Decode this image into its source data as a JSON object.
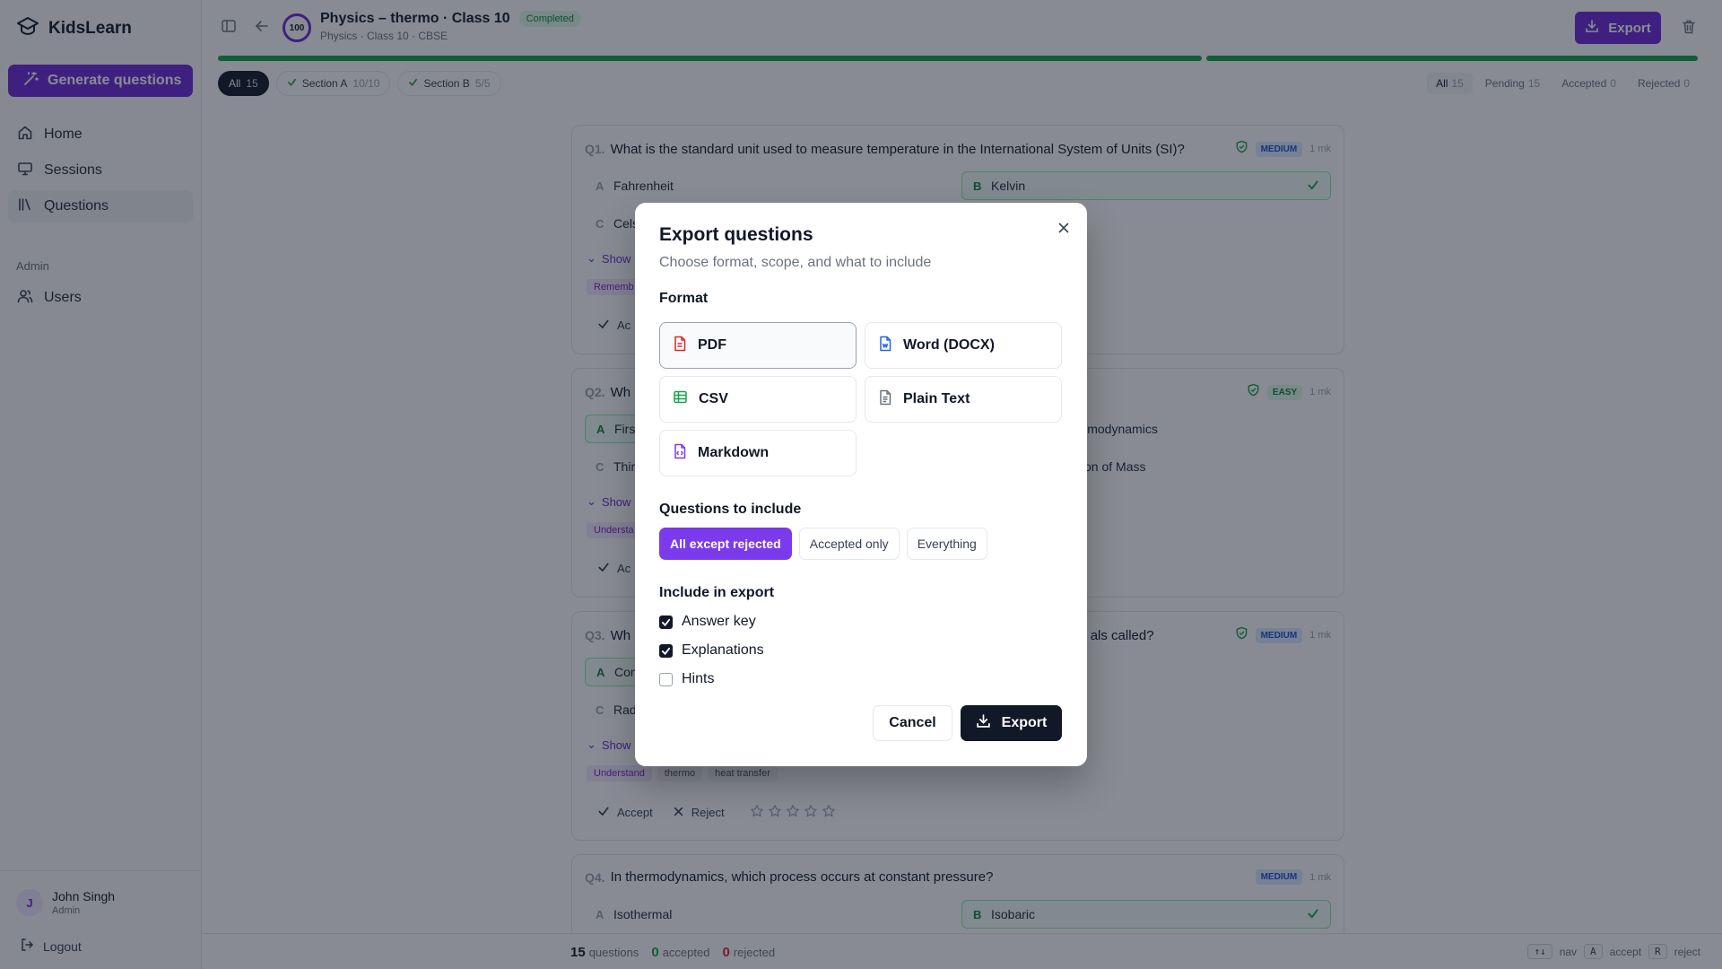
{
  "app": {
    "name": "KidsLearn"
  },
  "sidebar": {
    "generate_label": "Generate questions",
    "items": [
      {
        "label": "Home",
        "icon": "home-icon"
      },
      {
        "label": "Sessions",
        "icon": "monitor-icon"
      },
      {
        "label": "Questions",
        "icon": "library-icon",
        "active": true
      }
    ],
    "admin_label": "Admin",
    "admin_items": [
      {
        "label": "Users",
        "icon": "users-icon"
      }
    ],
    "user": {
      "initial": "J",
      "name": "John Singh",
      "role": "Admin"
    },
    "logout_label": "Logout"
  },
  "header": {
    "score": "100",
    "title": "Physics – thermo · Class 10",
    "status": "Completed",
    "subtitle": "Physics · Class 10 · CBSE",
    "export_label": "Export"
  },
  "progress": {
    "section_a_fraction": 1.0,
    "section_b_fraction": 1.0
  },
  "filters": {
    "chips": [
      {
        "label": "All",
        "count": "15"
      },
      {
        "label": "Section A",
        "count": "10/10"
      },
      {
        "label": "Section B",
        "count": "5/5"
      }
    ],
    "status_tabs": [
      {
        "label": "All",
        "count": "15"
      },
      {
        "label": "Pending",
        "count": "15"
      },
      {
        "label": "Accepted",
        "count": "0"
      },
      {
        "label": "Rejected",
        "count": "0"
      }
    ]
  },
  "questions": [
    {
      "num": "Q1.",
      "text": "What is the standard unit used to measure temperature in the International System of Units (SI)?",
      "difficulty": "MEDIUM",
      "marks": "1 mk",
      "options": [
        {
          "letter": "A",
          "text": "Fahrenheit"
        },
        {
          "letter": "B",
          "text": "Kelvin",
          "correct": true
        },
        {
          "letter": "C",
          "text": "Cels"
        }
      ],
      "show_label": "Show",
      "tags": [
        "Rememb"
      ],
      "accept_label": "Ac"
    },
    {
      "num": "Q2.",
      "text": "Wh",
      "difficulty": "EASY",
      "marks": "1 mk",
      "options": [
        {
          "letter": "A",
          "text": "Firs",
          "correct": true
        },
        {
          "letter": "B",
          "text": "hermodynamics"
        },
        {
          "letter": "C",
          "text": "Thir"
        },
        {
          "letter": "D",
          "text": "tion of Mass"
        }
      ],
      "show_label": "Show",
      "tags": [
        "Understa"
      ],
      "accept_label": "Ac"
    },
    {
      "num": "Q3.",
      "text": "Wh",
      "text_end": "als called?",
      "difficulty": "MEDIUM",
      "marks": "1 mk",
      "options": [
        {
          "letter": "A",
          "text": "Con",
          "correct": true
        },
        {
          "letter": "C",
          "text": "Rad"
        }
      ],
      "show_label": "Show",
      "tags": [
        "Understand",
        "thermo",
        "heat transfer"
      ],
      "accept_label": "Accept",
      "reject_label": "Reject"
    },
    {
      "num": "Q4.",
      "text": "In thermodynamics, which process occurs at constant pressure?",
      "difficulty": "MEDIUM",
      "marks": "1 mk",
      "options": [
        {
          "letter": "A",
          "text": "Isothermal"
        },
        {
          "letter": "B",
          "text": "Isobaric",
          "correct": true
        }
      ]
    }
  ],
  "bottombar": {
    "total": "15",
    "total_label": "questions",
    "accepted": "0",
    "accepted_label": "accepted",
    "rejected": "0",
    "rejected_label": "rejected",
    "shortcuts": [
      {
        "key": "↑↓",
        "label": "nav"
      },
      {
        "key": "A",
        "label": "accept"
      },
      {
        "key": "R",
        "label": "reject"
      }
    ]
  },
  "modal": {
    "title": "Export questions",
    "subtitle": "Choose format, scope, and what to include",
    "format_label": "Format",
    "formats": [
      {
        "label": "PDF",
        "selected": true,
        "color": "#dc2626"
      },
      {
        "label": "Word (DOCX)",
        "color": "#2563eb"
      },
      {
        "label": "CSV",
        "color": "#16a34a"
      },
      {
        "label": "Plain Text",
        "color": "#6b7280"
      },
      {
        "label": "Markdown",
        "color": "#7c3aed"
      }
    ],
    "scope_label": "Questions to include",
    "scopes": [
      "All except rejected",
      "Accepted only",
      "Everything"
    ],
    "include_label": "Include in export",
    "includes": [
      {
        "label": "Answer key",
        "checked": true
      },
      {
        "label": "Explanations",
        "checked": true
      },
      {
        "label": "Hints",
        "checked": false
      }
    ],
    "cancel_label": "Cancel",
    "export_label": "Export"
  },
  "colors": {
    "accent": "#6d28d9",
    "success": "#16a34a",
    "danger": "#dc2626"
  }
}
